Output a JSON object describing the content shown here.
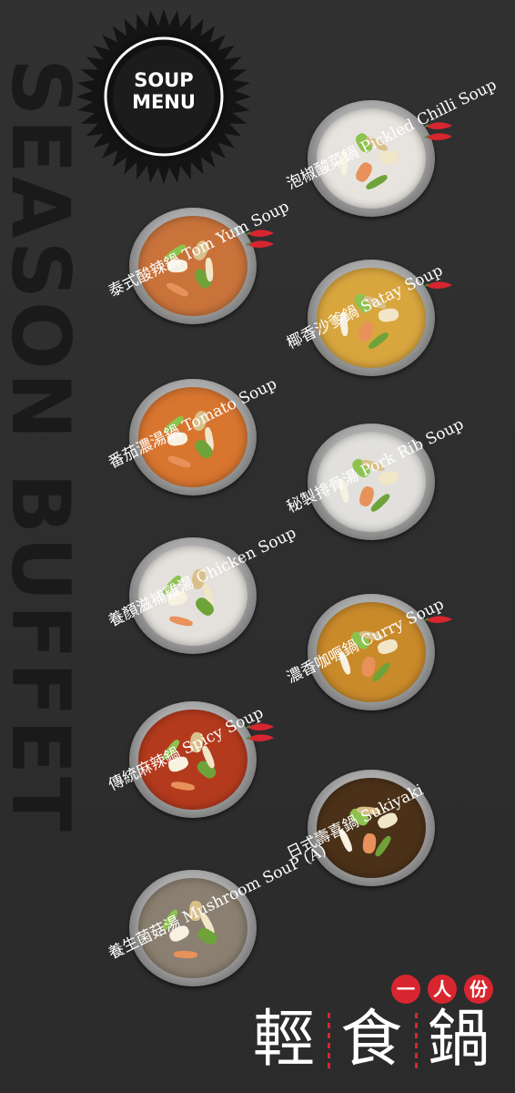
{
  "vertical_title": "SEASON BUFFET",
  "badge": {
    "line1": "SOUP",
    "line2": "MENU"
  },
  "brand": {
    "sub": [
      "一",
      "人",
      "份"
    ],
    "main": [
      "輕",
      "食",
      "鍋"
    ],
    "accent_color": "#d7262f"
  },
  "soups": [
    {
      "label": "泡椒酸菜鍋 Pickled Chilli Soup",
      "broth": "#e7e4df",
      "chili": 2
    },
    {
      "label": "泰式酸辣鍋 Tom Yum Soup",
      "broth": "#c9733b",
      "chili": 2
    },
    {
      "label": "椰香沙爹鍋 Satay Soup",
      "broth": "#d9a63e",
      "chili": 1
    },
    {
      "label": "番茄濃湯鍋 Tomato Soup",
      "broth": "#d8752f",
      "chili": 0
    },
    {
      "label": "秘製排骨湯 Pork Rib Soup",
      "broth": "#e1e0dc",
      "chili": 0
    },
    {
      "label": "養顏滋補雞湯 Chicken Soup",
      "broth": "#e4e1dc",
      "chili": 0
    },
    {
      "label": "濃香咖喱鍋 Curry Soup",
      "broth": "#c98a2a",
      "chili": 1
    },
    {
      "label": "傳統麻辣鍋 Spicy Soup",
      "broth": "#b43a1d",
      "chili": 2
    },
    {
      "label": "日式壽喜鍋 Sukiyaki",
      "broth": "#4b3118",
      "chili": 0
    },
    {
      "label": "養生菌菇湯 Mushroom SouP (A)",
      "broth": "#8a7f70",
      "chili": 0
    }
  ]
}
